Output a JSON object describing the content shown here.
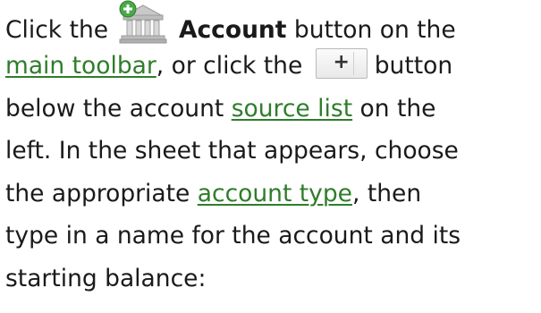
{
  "paragraph": {
    "l1_pre": "Click the",
    "l1_bold": "Account",
    "l1_post": "button on the",
    "main_toolbar_link": "main toolbar",
    "l2_mid": ", or click the",
    "l2_post": "button",
    "l3_pre": "below the account",
    "source_list_link": "source list",
    "l3_post": "on the",
    "l4": "left. In the sheet that appears, choose",
    "l5_pre": "the appropriate",
    "account_type_link": "account type",
    "l5_post": ", then",
    "l6": "type in a name for the account and its",
    "l7": "starting balance:"
  },
  "icons": {
    "account_toolbar_icon": "bank-building-with-plus-icon",
    "add_account_button": "plus-icon"
  },
  "colors": {
    "text": "#1a1a1a",
    "link": "#2f7d2b",
    "icon_plus_badge": "#4aa84a"
  }
}
